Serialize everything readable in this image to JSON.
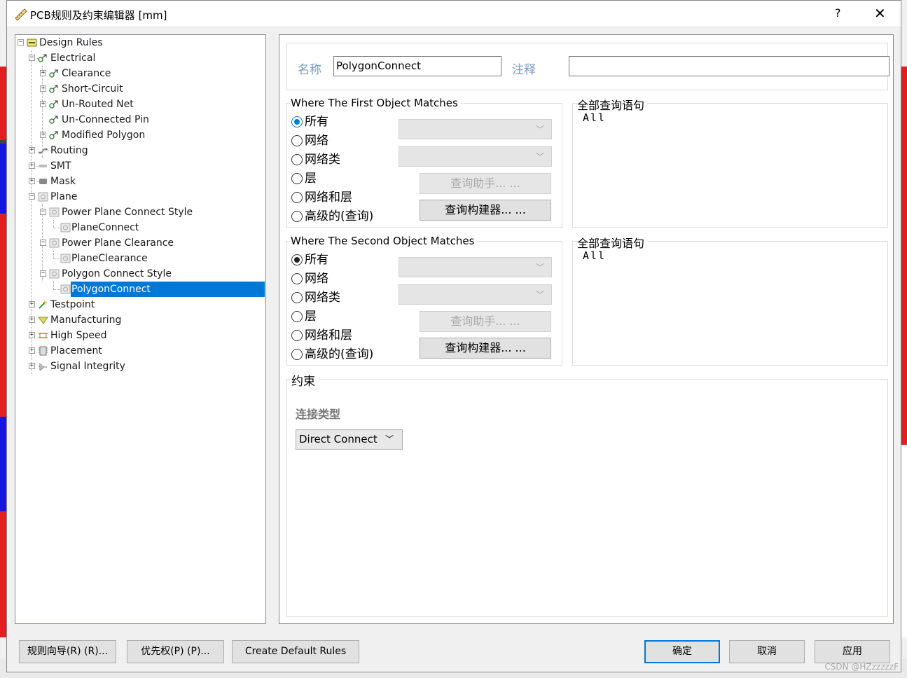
{
  "window": {
    "title": "PCB规则及约束编辑器 [mm]",
    "help": "?",
    "close": "✕"
  },
  "tree": {
    "items": [
      {
        "label": "Design Rules"
      },
      {
        "label": "Electrical"
      },
      {
        "label": "Clearance"
      },
      {
        "label": "Short-Circuit"
      },
      {
        "label": "Un-Routed Net"
      },
      {
        "label": "Un-Connected Pin"
      },
      {
        "label": "Modified Polygon"
      },
      {
        "label": "Routing"
      },
      {
        "label": "SMT"
      },
      {
        "label": "Mask"
      },
      {
        "label": "Plane"
      },
      {
        "label": "Power Plane Connect Style"
      },
      {
        "label": "PlaneConnect"
      },
      {
        "label": "Power Plane Clearance"
      },
      {
        "label": "PlaneClearance"
      },
      {
        "label": "Polygon Connect Style"
      },
      {
        "label": "PolygonConnect"
      },
      {
        "label": "Testpoint"
      },
      {
        "label": "Manufacturing"
      },
      {
        "label": "High Speed"
      },
      {
        "label": "Placement"
      },
      {
        "label": "Signal Integrity"
      }
    ],
    "selected": "PolygonConnect"
  },
  "rule": {
    "name_label": "名称",
    "name_value": "PolygonConnect",
    "comment_label": "注释",
    "comment_value": ""
  },
  "first_match": {
    "title": "Where The First Object Matches",
    "options": [
      "所有",
      "网络",
      "网络类",
      "层",
      "网络和层",
      "高级的(查询)"
    ],
    "selected": "所有",
    "query_helper": "查询助手... ...",
    "query_builder": "查询构建器... ...",
    "full_query_title": "全部查询语句",
    "full_query": "All"
  },
  "second_match": {
    "title": "Where The Second Object Matches",
    "options": [
      "所有",
      "网络",
      "网络类",
      "层",
      "网络和层",
      "高级的(查询)"
    ],
    "selected": "所有",
    "query_helper": "查询助手... ...",
    "query_builder": "查询构建器... ...",
    "full_query_title": "全部查询语句",
    "full_query": "All"
  },
  "constraints": {
    "title": "约束",
    "connect_type_label": "连接类型",
    "connect_type_value": "Direct Connect"
  },
  "buttons": {
    "rule_wizard": "规则向导(R) (R)...",
    "priorities": "优先权(P) (P)...",
    "create_default": "Create Default Rules",
    "ok": "确定",
    "cancel": "取消",
    "apply": "应用"
  },
  "watermark": "CSDN @HZzzzzzF",
  "colors": {
    "selection": "#0078d7",
    "label_blue": "#7a9cc6"
  }
}
